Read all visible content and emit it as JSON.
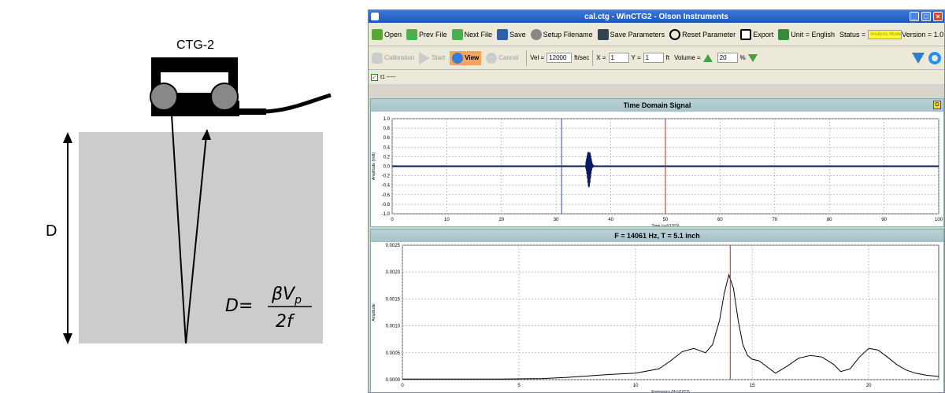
{
  "diagram": {
    "device_label": "CTG-2",
    "depth_label": "D",
    "formula": {
      "lhs": "D=",
      "numerator": "βV",
      "subscript": "p",
      "denominator": "2f"
    }
  },
  "window": {
    "title": "cal.ctg - WinCTG2 - Olson Instruments"
  },
  "toolbar1": {
    "open": "Open",
    "prev_file": "Prev File",
    "next_file": "Next File",
    "save": "Save",
    "setup_filename": "Setup Filename",
    "save_parameters": "Save Parameters",
    "reset_parameter": "Reset Parameter",
    "export": "Export",
    "unit": "Unit = English",
    "status_label": "Status =",
    "status_value": "Analysis Mode",
    "version": "Version = 1.0"
  },
  "toolbar2": {
    "calibration": "Calibration",
    "start": "Start",
    "view": "View",
    "cancel": "Cancel",
    "vel_label": "Vel =",
    "vel_value": "12000",
    "vel_unit": "ft/sec",
    "x_label": "X =",
    "x_value": "1",
    "y_label": "Y =",
    "y_value": "1",
    "xy_unit": "ft",
    "volume_label": "Volume =",
    "volume_value": "20",
    "volume_unit": "%"
  },
  "checkbox_row": {
    "label": "t1 -----"
  },
  "chart_data": [
    {
      "type": "line",
      "title": "Time Domain Signal",
      "xlabel": "Time (µs)(10^3)",
      "ylabel": "Amplitude (Volt)",
      "xlim": [
        0,
        100
      ],
      "ylim": [
        -1.0,
        1.0
      ],
      "x_ticks": [
        "0",
        "10",
        "20",
        "30",
        "40",
        "50",
        "60",
        "70",
        "80",
        "90",
        "100"
      ],
      "y_ticks": [
        "1.0",
        "0.8",
        "0.6",
        "0.4",
        "0.2",
        "0.0",
        "-0.2",
        "-0.4",
        "-0.6",
        "-0.8",
        "-1.0"
      ],
      "cursors": [
        {
          "x": 31,
          "color": "#3344cc"
        },
        {
          "x": 50,
          "color": "#cc2222"
        }
      ],
      "burst_center": 36,
      "grid": true,
      "series_color": "#0a1a5a"
    },
    {
      "type": "line",
      "title": "F = 14061 Hz, T = 5.1 inch",
      "xlabel": "Frequency (Hz)(10^3)",
      "ylabel": "Amplitude",
      "xlim": [
        0,
        23
      ],
      "ylim": [
        0,
        0.0025
      ],
      "x_ticks": [
        "0",
        "5",
        "10",
        "15",
        "20"
      ],
      "y_ticks": [
        "0.0025",
        "0.0020",
        "0.0015",
        "0.0010",
        "0.0005",
        "0.0000"
      ],
      "cursor": {
        "x": 14.06,
        "color": "#cc2222"
      },
      "grid": true,
      "series_color": "#000000",
      "x": [
        0,
        2,
        4,
        6,
        7,
        8,
        9,
        10,
        11,
        11.5,
        12,
        12.5,
        13,
        13.3,
        13.6,
        13.8,
        14,
        14.2,
        14.4,
        14.6,
        14.8,
        15,
        15.3,
        15.6,
        16,
        16.5,
        17,
        17.5,
        18,
        18.5,
        18.8,
        19.2,
        19.6,
        20,
        20.4,
        20.8,
        21.2,
        21.6,
        22,
        22.5,
        23
      ],
      "values": [
        1e-05,
        1e-05,
        1e-05,
        2e-05,
        4e-05,
        7e-05,
        0.0001,
        0.00012,
        0.0002,
        0.00035,
        0.00052,
        0.00058,
        0.0005,
        0.00065,
        0.0011,
        0.0016,
        0.00195,
        0.0017,
        0.0011,
        0.00065,
        0.00045,
        0.00038,
        0.00035,
        0.00025,
        0.00012,
        0.00025,
        0.0004,
        0.00045,
        0.00042,
        0.00028,
        0.00015,
        0.0002,
        0.00042,
        0.00058,
        0.00055,
        0.00042,
        0.00028,
        0.00018,
        0.00012,
        8e-05,
        6e-05
      ]
    }
  ]
}
